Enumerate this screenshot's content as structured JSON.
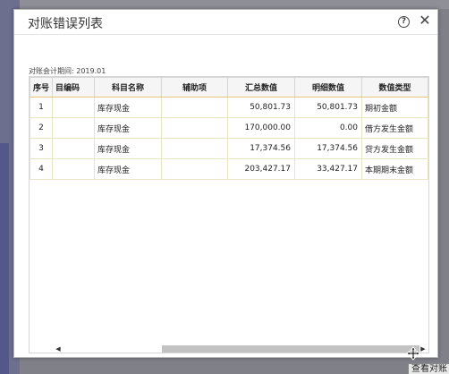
{
  "background": {
    "bottom_button_label": "查看对账"
  },
  "dialog": {
    "title": "对账错误列表",
    "help_icon": "help-circle-icon",
    "close_icon": "close-icon"
  },
  "period": {
    "label": "对账会计期间:",
    "value": "2019.01"
  },
  "table": {
    "headers": [
      "序号",
      "目编码",
      "科目名称",
      "辅助项",
      "汇总数值",
      "明细数值",
      "数值类型"
    ],
    "rows": [
      [
        "1",
        "",
        "库存现金",
        "",
        "50,801.73",
        "50,801.73",
        "期初金额"
      ],
      [
        "2",
        "",
        "库存现金",
        "",
        "170,000.00",
        "0.00",
        "借方发生金额"
      ],
      [
        "3",
        "",
        "库存现金",
        "",
        "17,374.56",
        "17,374.56",
        "贷方发生金额"
      ],
      [
        "4",
        "",
        "库存现金",
        "",
        "203,427.17",
        "33,427.17",
        "本期期末金额"
      ]
    ]
  },
  "colors": {
    "accent_border": "#e8c47a",
    "grid_border": "#e6e6c6"
  }
}
